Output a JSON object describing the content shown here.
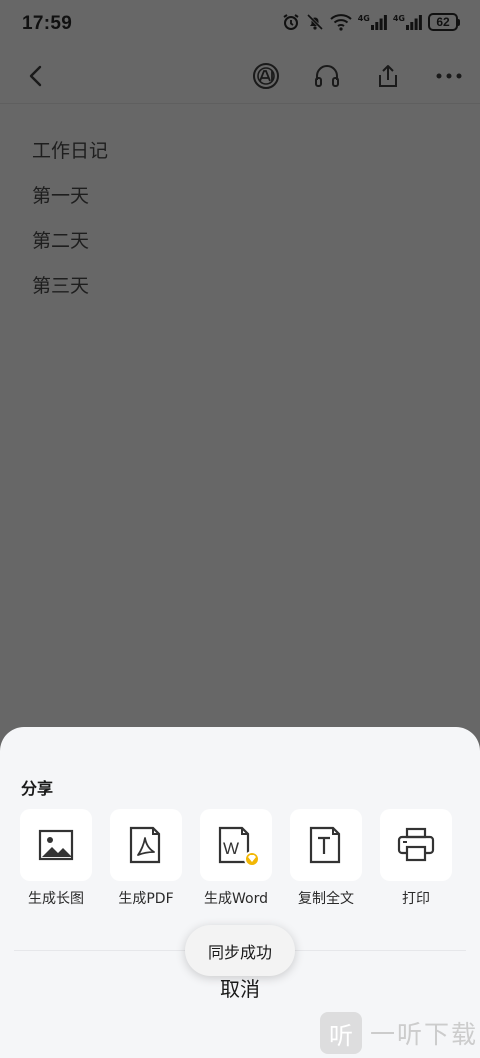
{
  "status_bar": {
    "time": "17:59",
    "network_1": "4G",
    "network_2": "4G",
    "battery_level": "62",
    "icons": [
      "alarm-icon",
      "mute-bell-icon",
      "wifi-icon",
      "signal-icon",
      "signal-icon",
      "battery-icon"
    ]
  },
  "toolbar": {
    "icons": [
      "back-arrow-icon",
      "ai-icon",
      "headphones-icon",
      "share-icon",
      "more-icon"
    ]
  },
  "note": {
    "lines": [
      "工作日记",
      "第一天",
      "第二天",
      "第三天"
    ]
  },
  "share_sheet": {
    "title": "分享",
    "actions": [
      {
        "label": "生成长图",
        "icon": "image-icon"
      },
      {
        "label": "生成PDF",
        "icon": "pdf-icon"
      },
      {
        "label": "生成Word",
        "icon": "word-icon",
        "badge": "premium-badge-icon"
      },
      {
        "label": "复制全文",
        "icon": "text-copy-icon"
      },
      {
        "label": "打印",
        "icon": "printer-icon"
      }
    ],
    "cancel_label": "取消"
  },
  "toast": {
    "message": "同步成功"
  },
  "watermark": {
    "logo_char": "听",
    "text": "一听下载"
  },
  "colors": {
    "overlay": "#676767",
    "sheet_background": "#f5f6f8",
    "tile_background": "#ffffff",
    "premium_badge": "#f2b705"
  }
}
